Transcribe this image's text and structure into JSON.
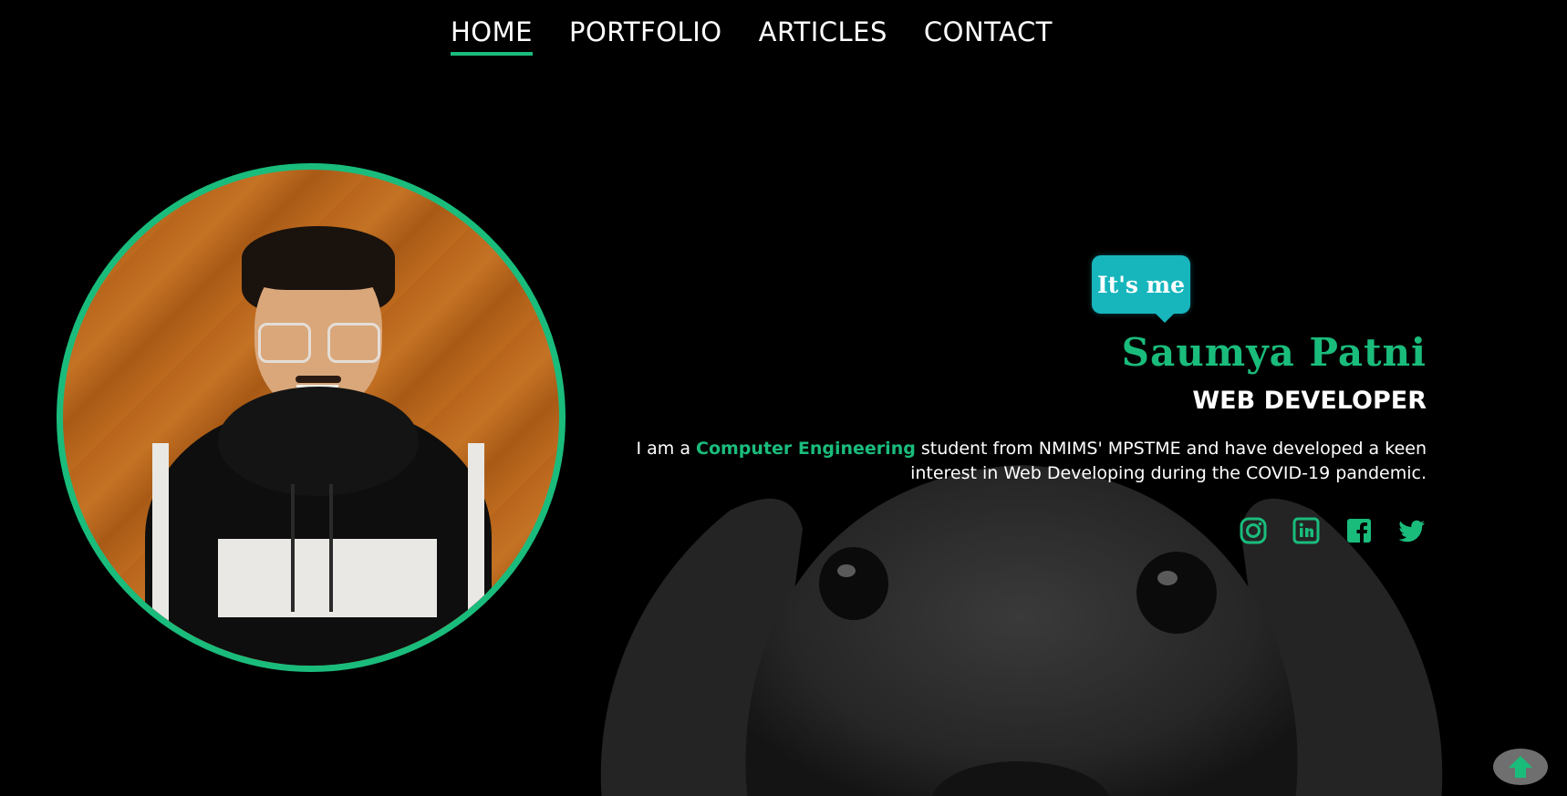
{
  "nav": {
    "items": [
      {
        "label": "HOME",
        "active": true
      },
      {
        "label": "PORTFOLIO",
        "active": false
      },
      {
        "label": "ARTICLES",
        "active": false
      },
      {
        "label": "CONTACT",
        "active": false
      }
    ]
  },
  "hero": {
    "bubble_text": "It's me",
    "name": "Saumya Patni",
    "role": "WEB DEVELOPER",
    "bio_prefix": "I am a ",
    "bio_highlight": "Computer Engineering",
    "bio_suffix": " student from NMIMS' MPSTME and have developed a keen interest in Web Developing during the COVID-19 pandemic."
  },
  "socials": [
    {
      "icon": "instagram-icon"
    },
    {
      "icon": "linkedin-icon"
    },
    {
      "icon": "facebook-icon"
    },
    {
      "icon": "twitter-icon"
    }
  ],
  "colors": {
    "accent": "#1abc7c",
    "bubble": "#17b6bd",
    "background": "#000000"
  },
  "scroll_top": {
    "icon": "arrow-up-icon"
  }
}
